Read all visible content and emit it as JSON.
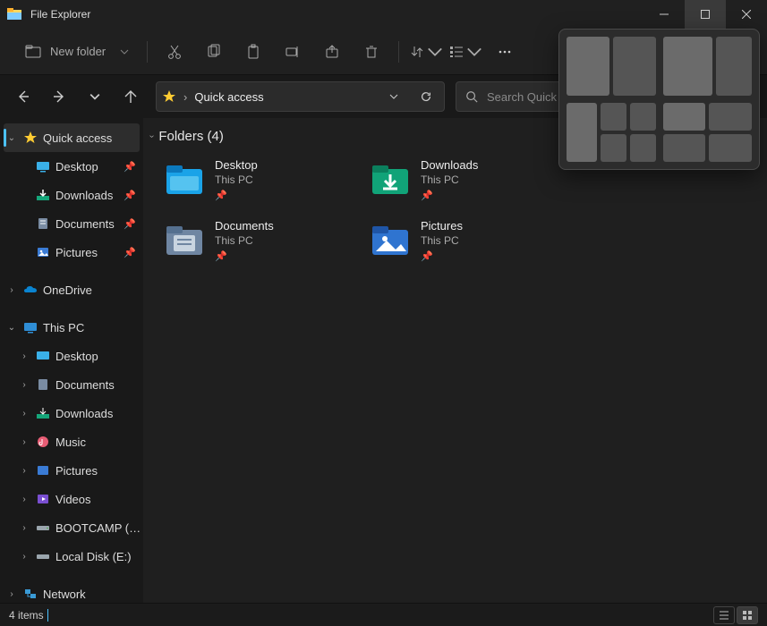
{
  "window": {
    "title": "File Explorer"
  },
  "toolbar": {
    "new_folder": "New folder"
  },
  "address": {
    "location": "Quick access"
  },
  "search": {
    "placeholder": "Search Quick access"
  },
  "sidebar": {
    "quick_access": {
      "label": "Quick access",
      "items": [
        {
          "label": "Desktop",
          "icon": "desktop",
          "pinned": true
        },
        {
          "label": "Downloads",
          "icon": "downloads",
          "pinned": true
        },
        {
          "label": "Documents",
          "icon": "documents",
          "pinned": true
        },
        {
          "label": "Pictures",
          "icon": "pictures",
          "pinned": true
        }
      ]
    },
    "onedrive": {
      "label": "OneDrive"
    },
    "this_pc": {
      "label": "This PC",
      "items": [
        {
          "label": "Desktop",
          "icon": "desktop"
        },
        {
          "label": "Documents",
          "icon": "documents"
        },
        {
          "label": "Downloads",
          "icon": "downloads"
        },
        {
          "label": "Music",
          "icon": "music"
        },
        {
          "label": "Pictures",
          "icon": "pictures"
        },
        {
          "label": "Videos",
          "icon": "videos"
        },
        {
          "label": "BOOTCAMP (C:)",
          "icon": "drive"
        },
        {
          "label": "Local Disk (E:)",
          "icon": "drive"
        }
      ]
    },
    "network": {
      "label": "Network"
    }
  },
  "content": {
    "section_title": "Folders (4)",
    "folders": [
      {
        "name": "Desktop",
        "sub": "This PC",
        "icon": "desktop-big"
      },
      {
        "name": "Downloads",
        "sub": "This PC",
        "icon": "downloads-big"
      },
      {
        "name": "Documents",
        "sub": "This PC",
        "icon": "documents-big"
      },
      {
        "name": "Pictures",
        "sub": "This PC",
        "icon": "pictures-big"
      }
    ]
  },
  "statusbar": {
    "count_text": "4 items"
  }
}
